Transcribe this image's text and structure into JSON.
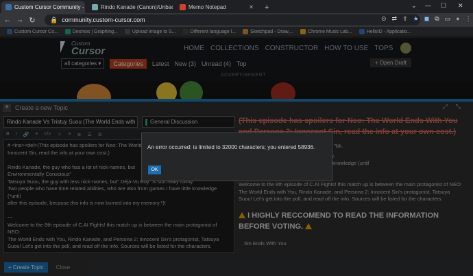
{
  "browser": {
    "tabs": [
      {
        "title": "Custom Cursor Community - Cr",
        "fav_color": "#3a6ea5",
        "active": true
      },
      {
        "title": "Rindo Kanade (Canon)/Unback",
        "fav_color": "#7aa",
        "active": false
      },
      {
        "title": "Memo Notepad",
        "fav_color": "#d04030",
        "active": false
      }
    ],
    "new_tab": "+",
    "url": "community.custom-cursor.com",
    "bookmarks": [
      {
        "label": "Custom Cursor Co...",
        "color": "#3a6ea5"
      },
      {
        "label": "Desmos | Graphing...",
        "color": "#2a7"
      },
      {
        "label": "Upload Image to S...",
        "color": "#555"
      },
      {
        "label": "Different language l...",
        "color": "#444"
      },
      {
        "label": "Sketchpad - Draw,...",
        "color": "#c84"
      },
      {
        "label": "Chrome Music Lab...",
        "color": "#da2"
      },
      {
        "label": "HelloID - Applicatio...",
        "color": "#37b"
      }
    ]
  },
  "site": {
    "logo_small": "Custom",
    "logo_big": "Cursor",
    "nav": [
      "HOME",
      "COLLECTIONS",
      "CONSTRUCTOR",
      "HOW TO USE",
      "TOPS"
    ],
    "subnav": {
      "category_dropdown": "all categories",
      "category_button": "Categories",
      "links": [
        "Latest",
        "New (3)",
        "Unread (4)",
        "Top"
      ]
    },
    "open_draft": "+ Open Draft",
    "ad_label": "ADVERTISEMENT"
  },
  "composer": {
    "header": "Create a new Topic",
    "title_value": "Rindo Kanade Vs Tristuy Suou (The World Ends with Yo",
    "category_value": "General Discussion",
    "format_icons": [
      "B",
      "I",
      "🔗",
      "❝",
      "</>",
      "☺",
      "≡",
      "≣",
      "☰",
      "⚙"
    ],
    "editor_lines": [
      "# <ins><del>(This episode has spoilers for Neo: The World E",
      "Innocent Sin, read the info at your own cost.)",
      "",
      "Rindo Kanade, the guy who has a lot of nick-names, but",
      "Environmentally Conscious\"",
      "Tatsuya Suou, the guy with less nick-names, but\" Déjà-Vu Boy\" is still really funny.",
      "Two people who have time related abilities, who are also from games I have little knowledge (*until",
      "after this episode, because this info is now burned into my memory.*)!",
      "",
      "---",
      "Welcome to the 8th episode of C.AI Fights! this match up is between the main protagonist of NEO:",
      "The World Ends with You, Rindo Kanade, and Persona 2: Innocent Sin's protagonist, Tatsuya",
      "Suou! Let's get into the poll, and read off the info. Sources will be listed for the characters.",
      "",
      "---",
      "# :warning: I HIGHLY RECCOMEND TO READ THE INFORMATION BEFORE VOTING. :warning:"
    ],
    "preview": {
      "strike_heading": "(This episode has spoilers for Neo: The World Ends With You and Persona 2: Innocent Sin, read the info at your own cost.)",
      "line1": "ick-names, but my favorite one has to be: \"Mr.",
      "line2": "mes, but\" Déjà-Vu Boy\" is still really funny.",
      "line3": "es, who are also from games I have little knowledge (until",
      "line4": "w burned into my memory.)!",
      "para": "Welcome to the 8th episode of C.AI Fights! this match up is between the main protagonist of NEO: The World Ends with You, Rindo Kanade, and Persona 2: Innocent Sin's protagonist, Tatsuya Suou! Let's get into the poll, and read off the info. Sources will be listed for the characters.",
      "warning_heading": "I HIGHLY RECCOMEND TO READ THE INFORMATION BEFORE VOTING.",
      "subtext": "Sin Ends With You"
    },
    "create_button": "+ Create Topic",
    "close_link": "Close"
  },
  "modal": {
    "message": "An error occurred: is limited to 32000 characters; you entered 58936.",
    "ok": "OK"
  }
}
